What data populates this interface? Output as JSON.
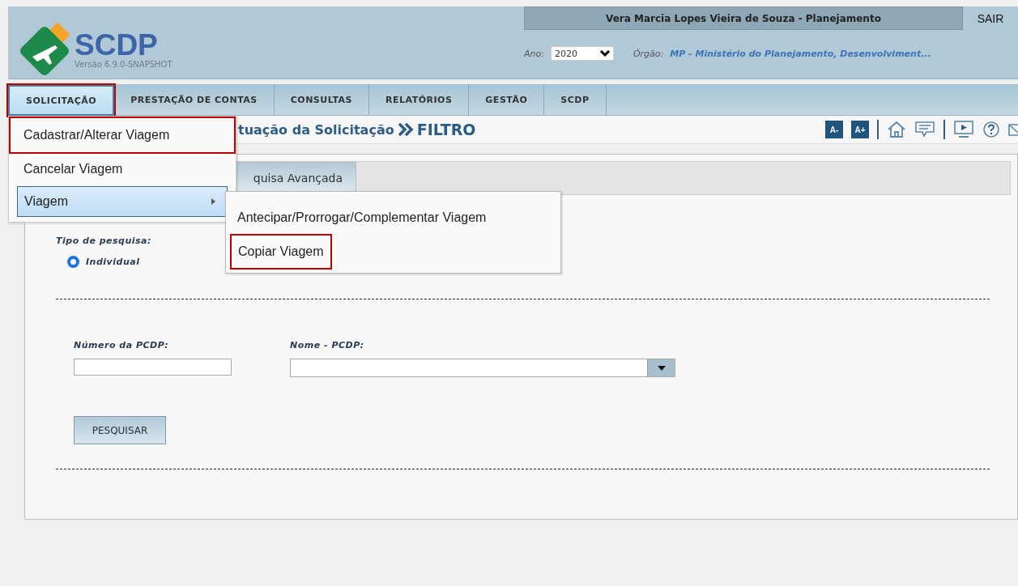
{
  "header": {
    "logo_title": "SCDP",
    "version": "Versão 6.9.0-SNAPSHOT",
    "user": "Vera Marcia Lopes Vieira de Souza - Planejamento",
    "logout": "SAIR",
    "year_label": "Ano:",
    "year_value": "2020",
    "org_label": "Órgão:",
    "org_value": "MP - Ministério do Planejamento, Desenvolviment..."
  },
  "menu_bar": [
    {
      "label": "SOLICITAÇÃO",
      "selected": true,
      "highlighted": true
    },
    {
      "label": "PRESTAÇÃO DE CONTAS",
      "selected": false,
      "highlighted": false
    },
    {
      "label": "CONSULTAS",
      "selected": false,
      "highlighted": false
    },
    {
      "label": "RELATÓRIOS",
      "selected": false,
      "highlighted": false
    },
    {
      "label": "GESTÃO",
      "selected": false,
      "highlighted": false
    },
    {
      "label": "SCDP",
      "selected": false,
      "highlighted": false
    }
  ],
  "dropdown": [
    {
      "label": "Cadastrar/Alterar Viagem",
      "selected": false,
      "highlighted": true,
      "has_submenu": false
    },
    {
      "label": "Cancelar Viagem",
      "selected": false,
      "highlighted": false,
      "has_submenu": false
    },
    {
      "label": "Viagem",
      "selected": true,
      "highlighted": false,
      "has_submenu": true
    }
  ],
  "submenu": [
    {
      "label": "Antecipar/Prorrogar/Complementar Viagem",
      "highlighted": false
    },
    {
      "label": "Copiar Viagem",
      "highlighted": true
    }
  ],
  "breadcrumb": {
    "parent": "tuação da Solicitação",
    "current": "FILTRO"
  },
  "toolbar": {
    "font_smaller": "A-",
    "font_larger": "A+"
  },
  "tab": {
    "label": "quisa Avançada"
  },
  "form": {
    "search_type_label": "Tipo de pesquisa:",
    "radios": [
      {
        "label": "Individual",
        "selected": true
      }
    ],
    "number_label": "Número da PCDP:",
    "name_label": "Nome - PCDP:",
    "search_button": "PESQUISAR"
  }
}
